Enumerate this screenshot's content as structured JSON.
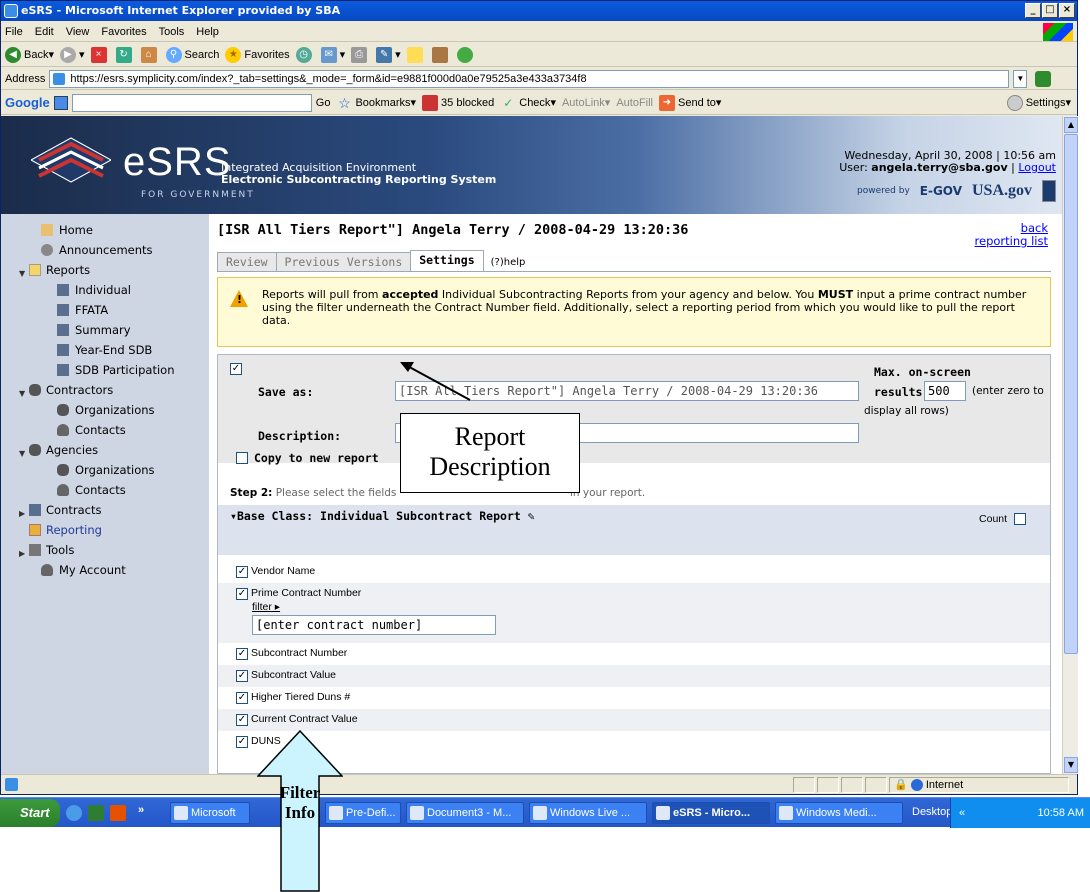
{
  "window": {
    "title": "eSRS - Microsoft Internet Explorer provided by SBA",
    "buttons": [
      "_",
      "□",
      "×"
    ]
  },
  "menu": [
    "File",
    "Edit",
    "View",
    "Favorites",
    "Tools",
    "Help"
  ],
  "toolbar": {
    "back": "Back",
    "search": "Search",
    "favorites": "Favorites"
  },
  "address": {
    "label": "Address",
    "url": "https://esrs.symplicity.com/index?_tab=settings&_mode=_form&id=e9881f000d0a0e79525a3e433a3734f8",
    "go": "Go"
  },
  "google_bar": {
    "brand": "Google",
    "go": "Go",
    "bookmarks": "Bookmarks",
    "blocked": "35 blocked",
    "check": "Check",
    "autolink": "AutoLink",
    "autofill": "AutoFill",
    "sendto": "Send to",
    "settings": "Settings"
  },
  "header": {
    "logo": "eSRS",
    "logo_sub": "FOR GOVERNMENT",
    "subtitle1": "Integrated Acquisition Environment",
    "subtitle2": "Electronic Subcontracting Reporting System",
    "datetime": "Wednesday, April 30, 2008 | 10:56 am",
    "user_prefix": "User: ",
    "user": "angela.terry@sba.gov",
    "logout": "Logout",
    "powered": "powered by",
    "egov": "E-GOV",
    "usagov": "USA.gov"
  },
  "sidebar": {
    "home": "Home",
    "announcements": "Announcements",
    "reports": "Reports",
    "individual": "Individual",
    "ffata": "FFATA",
    "summary": "Summary",
    "yearend": "Year-End SDB",
    "sdbpart": "SDB Participation",
    "contractors": "Contractors",
    "c_orgs": "Organizations",
    "c_contacts": "Contacts",
    "agencies": "Agencies",
    "a_orgs": "Organizations",
    "a_contacts": "Contacts",
    "contracts": "Contracts",
    "reporting": "Reporting",
    "tools": "Tools",
    "myaccount": "My Account"
  },
  "main": {
    "title": "[ISR All Tiers Report\"] Angela Terry / 2008-04-29 13:20:36",
    "back1": "back",
    "back2": "reporting list",
    "tabs": [
      "Review",
      "Previous Versions",
      "Settings"
    ],
    "help": "help",
    "notice_1": "Reports will pull from ",
    "notice_b1": "accepted",
    "notice_2": " Individual Subcontracting Reports from your agency and below. You ",
    "notice_b2": "MUST",
    "notice_3": " input a prime contract number using the filter underneath the Contract Number field. Additionally, select a reporting period from which you would like to pull the report data."
  },
  "form": {
    "save_as_label": "Save as:",
    "save_as_value": "[ISR All Tiers Report\"] Angela Terry / 2008-04-29 13:20:36",
    "max_label1": "Max. on-screen",
    "max_label2": "results:",
    "max_value": "500",
    "max_hint1": "(enter zero to",
    "max_hint2": "display all rows)",
    "description_label": "Description:",
    "copy_label": "Copy to new report",
    "step_b": "Step 2:",
    "step_text": " Please select the fields",
    "step_tail": "in your report.",
    "base_class": "Base Class: Individual Subcontract Report",
    "count": "Count",
    "fields": [
      "Vendor Name",
      "Prime Contract Number",
      "Subcontract Number",
      "Subcontract Value",
      "Higher Tiered Duns #",
      "Current Contract Value",
      "DUNS"
    ],
    "filter": "filter",
    "contract_placeholder": "[enter contract number]"
  },
  "status": {
    "zone": "Internet"
  },
  "taskbar": {
    "start": "Start",
    "tasks": [
      "Microsoft",
      "Pre-Defi...",
      "Document3 - M...",
      "Windows Live ...",
      "eSRS - Micro...",
      "Windows Medi..."
    ],
    "desktop": "Desktop",
    "clock": "10:58 AM"
  },
  "annotations": {
    "report_desc_1": "Report",
    "report_desc_2": "Description",
    "filter_1": "Filter",
    "filter_2": "Info"
  }
}
